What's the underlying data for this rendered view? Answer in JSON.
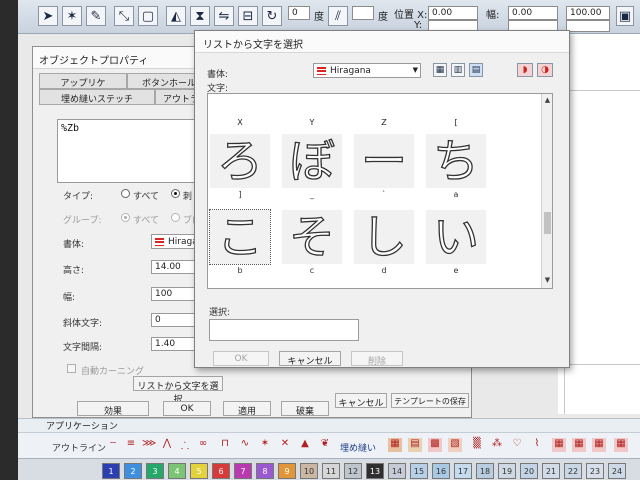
{
  "toolbar": {
    "degree_label_1": "度",
    "degree_value_1": "0",
    "degree_label_2": "度",
    "position_x_label": "位置 X:",
    "position_x_value": "0.00",
    "position_y_label": "Y:",
    "width_label": "幅:",
    "width_value": "0.00",
    "percent_value": "100.00"
  },
  "object_dialog": {
    "title": "オブジェクトプロパティ",
    "tabs": [
      "アップリケ",
      "ボタンホール",
      "埋め縫いステッチ",
      "アウトライン"
    ],
    "text_content": "%Zb",
    "type_label": "タイプ:",
    "type_options": [
      "すべて",
      "刺しゅう"
    ],
    "group_label": "グループ:",
    "group_options": [
      "すべて",
      "ブロック"
    ],
    "font_label": "書体:",
    "font_value": "Hiragana",
    "height_label": "高さ:",
    "height_value": "14.00",
    "width_label": "幅:",
    "width_value": "100",
    "slant_label": "斜体文字:",
    "slant_value": "0",
    "spacing_label": "文字間隔:",
    "spacing_value": "1.40",
    "auto_kerning_label": "自動カーニング",
    "select_from_list_button": "リストから文字を選択",
    "bottom_buttons": [
      "効果",
      "OK",
      "適用",
      "破棄",
      "キャンセル",
      "テンプレートの保存"
    ]
  },
  "select_dialog": {
    "title": "リストから文字を選択",
    "font_label": "書体:",
    "font_value": "Hiragana",
    "chars_label": "文字:",
    "top_captions": [
      "X",
      "Y",
      "Z",
      "["
    ],
    "rows": [
      [
        {
          "glyph": "ろ",
          "cap": "]"
        },
        {
          "glyph": "ぼ",
          "cap": "_"
        },
        {
          "glyph": "ー",
          "cap": "`"
        },
        {
          "glyph": "ち",
          "cap": "a"
        }
      ],
      [
        {
          "glyph": "こ",
          "cap": "b"
        },
        {
          "glyph": "そ",
          "cap": "c"
        },
        {
          "glyph": "し",
          "cap": "d"
        },
        {
          "glyph": "い",
          "cap": "e"
        }
      ]
    ],
    "selection_label": "選択:",
    "buttons": [
      "OK",
      "キャンセル",
      "削除"
    ]
  },
  "bottom": {
    "app_label": "アプリケーション",
    "outline_label": "アウトライン",
    "fill_label": "埋め縫い",
    "palette": [
      {
        "n": "1",
        "c": "#2b3fb0"
      },
      {
        "n": "2",
        "c": "#3f8fe0"
      },
      {
        "n": "3",
        "c": "#26a86a"
      },
      {
        "n": "4",
        "c": "#7cc576"
      },
      {
        "n": "5",
        "c": "#e4d23c"
      },
      {
        "n": "6",
        "c": "#d83a3a"
      },
      {
        "n": "7",
        "c": "#b93ab0"
      },
      {
        "n": "8",
        "c": "#9b59d0"
      },
      {
        "n": "9",
        "c": "#e2963a"
      },
      {
        "n": "10",
        "c": "#c9b7a4"
      },
      {
        "n": "11",
        "c": "#d6d6d6"
      },
      {
        "n": "12",
        "c": "#bfc5cc"
      },
      {
        "n": "13",
        "c": "#2f2f2f"
      },
      {
        "n": "14",
        "c": "#c7cbd8"
      },
      {
        "n": "15",
        "c": "#b7d0e8"
      },
      {
        "n": "16",
        "c": "#a9c8e3"
      },
      {
        "n": "17",
        "c": "#c5dcef"
      },
      {
        "n": "18",
        "c": "#b8cde0"
      },
      {
        "n": "19",
        "c": "#cfd9e4"
      },
      {
        "n": "20",
        "c": "#c2d4e6"
      },
      {
        "n": "21",
        "c": "#d2dce8"
      },
      {
        "n": "22",
        "c": "#c9d6e3"
      },
      {
        "n": "23",
        "c": "#d7e0ea"
      },
      {
        "n": "24",
        "c": "#cdd9e6"
      }
    ]
  }
}
